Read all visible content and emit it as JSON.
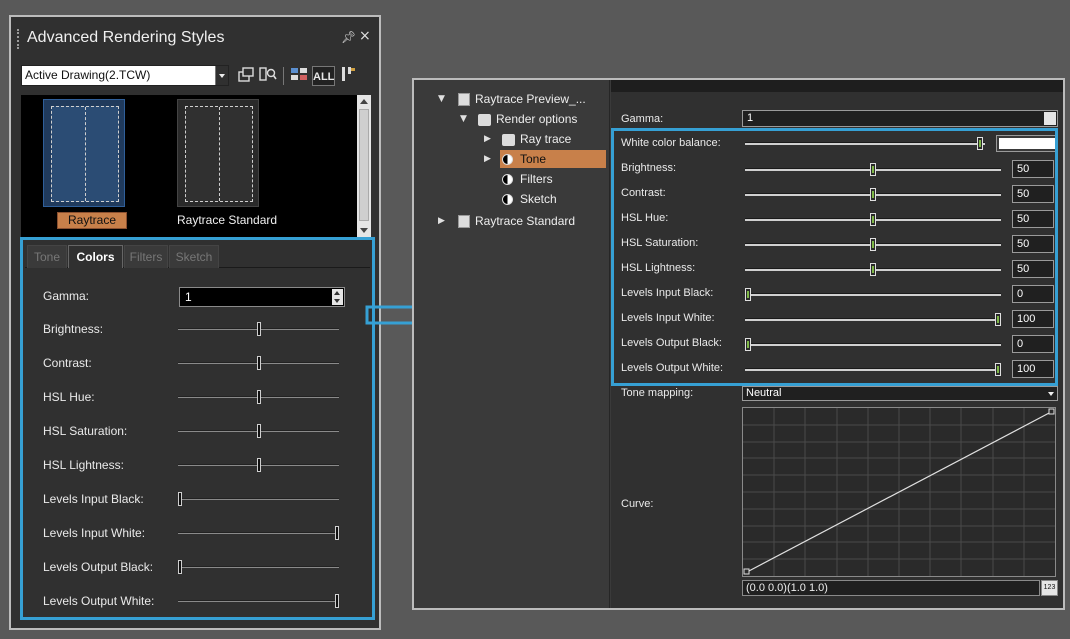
{
  "left_panel": {
    "title": "Advanced Rendering Styles",
    "pin_glyph": " ¤",
    "close_glyph": "×",
    "drawing_select": {
      "value": "Active Drawing(2.TCW)"
    },
    "toolbar": {
      "all_label": "ALL"
    },
    "thumbnails": [
      {
        "label": "Raytrace",
        "selected": true
      },
      {
        "label": "Raytrace Standard",
        "selected": false
      }
    ],
    "tabs": [
      {
        "label": "Tone",
        "active": false
      },
      {
        "label": "Colors",
        "active": true
      },
      {
        "label": "Filters",
        "active": false
      },
      {
        "label": "Sketch",
        "active": false
      }
    ],
    "gamma": {
      "label": "Gamma:",
      "value": "1"
    },
    "sliders": [
      {
        "label": "Brightness:",
        "position": 0.5
      },
      {
        "label": "Contrast:",
        "position": 0.5
      },
      {
        "label": "HSL Hue:",
        "position": 0.5
      },
      {
        "label": "HSL Saturation:",
        "position": 0.5
      },
      {
        "label": "HSL Lightness:",
        "position": 0.5
      },
      {
        "label": "Levels Input Black:",
        "position": 0.0
      },
      {
        "label": "Levels Input White:",
        "position": 1.0
      },
      {
        "label": "Levels Output Black:",
        "position": 0.0
      },
      {
        "label": "Levels Output White:",
        "position": 1.0
      }
    ]
  },
  "right_panel": {
    "tree": [
      {
        "label": "Raytrace Preview_...",
        "icon": "document-icon",
        "expanded": true,
        "level": 0
      },
      {
        "label": "Render options",
        "icon": "render-options-icon",
        "expanded": true,
        "level": 1
      },
      {
        "label": "Ray trace",
        "icon": "ray-trace-icon",
        "expanded": false,
        "level": 2
      },
      {
        "label": "Tone",
        "icon": "tone-icon",
        "expanded": false,
        "level": 2,
        "selected": true
      },
      {
        "label": "Filters",
        "icon": "tone-icon",
        "level": 2
      },
      {
        "label": "Sketch",
        "icon": "tone-icon",
        "level": 2
      },
      {
        "label": "Raytrace Standard",
        "icon": "document-icon",
        "expanded": false,
        "level": 0
      }
    ],
    "gamma": {
      "label": "Gamma:",
      "value": "1"
    },
    "white_color_balance": {
      "label": "White color balance:",
      "position": 0.99,
      "swatch_color": "#ffffff"
    },
    "sliders": [
      {
        "label": "Brightness:",
        "value": "50",
        "position": 0.5
      },
      {
        "label": "Contrast:",
        "value": "50",
        "position": 0.5
      },
      {
        "label": "HSL Hue:",
        "value": "50",
        "position": 0.5
      },
      {
        "label": "HSL Saturation:",
        "value": "50",
        "position": 0.5
      },
      {
        "label": "HSL Lightness:",
        "value": "50",
        "position": 0.5
      },
      {
        "label": "Levels Input Black:",
        "value": "0",
        "position": 0.0
      },
      {
        "label": "Levels Input White:",
        "value": "100",
        "position": 1.0
      },
      {
        "label": "Levels Output Black:",
        "value": "0",
        "position": 0.0
      },
      {
        "label": "Levels Output White:",
        "value": "100",
        "position": 1.0
      }
    ],
    "tone_mapping": {
      "label": "Tone mapping:",
      "value": "Neutral"
    },
    "curve": {
      "label": "Curve:",
      "readout": "(0.0 0.0)(1.0 1.0)",
      "readout_button": "123"
    }
  },
  "colors": {
    "highlight": "#36a0d4",
    "selection": "#c8804a",
    "slider_grip": "#7fb848"
  }
}
